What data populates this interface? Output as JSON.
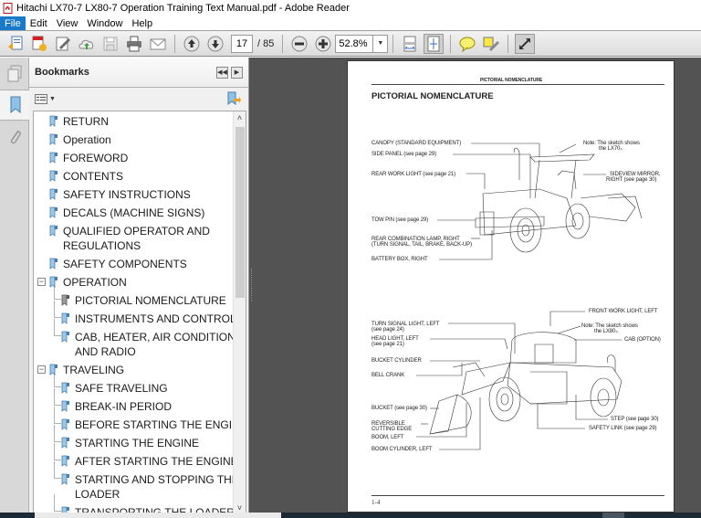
{
  "window": {
    "title": "Hitachi LX70-7 LX80-7 Operation Training Text Manual.pdf - Adobe Reader"
  },
  "menubar": {
    "items": [
      "File",
      "Edit",
      "View",
      "Window",
      "Help"
    ],
    "active": "File"
  },
  "toolbar": {
    "buttons": [
      {
        "icon": "create-pdf-icon",
        "label": "Create"
      },
      {
        "icon": "export-pdf-icon",
        "label": "Export"
      },
      {
        "icon": "sign-icon",
        "label": "Sign"
      },
      {
        "icon": "upload-cloud-icon",
        "label": "Upload"
      },
      {
        "icon": "save-icon",
        "label": "Save"
      },
      {
        "icon": "print-icon",
        "label": "Print"
      },
      {
        "icon": "email-icon",
        "label": "Email"
      }
    ],
    "current_page": "17",
    "total_pages": "/ 85",
    "zoom": "52.8%"
  },
  "panel": {
    "title": "Bookmarks",
    "bookmarks": [
      {
        "label": "RETURN",
        "level": 0
      },
      {
        "label": "Operation",
        "level": 0
      },
      {
        "label": "FOREWORD",
        "level": 0
      },
      {
        "label": "CONTENTS",
        "level": 0
      },
      {
        "label": "SAFETY INSTRUCTIONS",
        "level": 0
      },
      {
        "label": "DECALS (MACHINE SIGNS)",
        "level": 0
      },
      {
        "label": "QUALIFIED OPERATOR AND",
        "label2": "REGULATIONS",
        "level": 0
      },
      {
        "label": "SAFETY COMPONENTS",
        "level": 0
      },
      {
        "label": "OPERATION",
        "level": 0,
        "expanded": true
      },
      {
        "label": "PICTORIAL NOMENCLATURE",
        "level": 1,
        "current": true
      },
      {
        "label": "INSTRUMENTS AND CONTROLS",
        "level": 1
      },
      {
        "label": "CAB, HEATER, AIR CONDITIONER,",
        "label2": "AND RADIO",
        "level": 1
      },
      {
        "label": "TRAVELING",
        "level": 0,
        "expanded": true
      },
      {
        "label": "SAFE TRAVELING",
        "level": 1
      },
      {
        "label": "BREAK-IN PERIOD",
        "level": 1
      },
      {
        "label": "BEFORE STARTING THE ENGINE",
        "level": 1
      },
      {
        "label": "STARTING THE ENGINE",
        "level": 1
      },
      {
        "label": "AFTER STARTING THE ENGINE",
        "level": 1
      },
      {
        "label": "STARTING AND STOPPING THE",
        "label2": "LOADER",
        "level": 1
      },
      {
        "label": "TRANSPORTING THE LOADER",
        "level": 1
      }
    ]
  },
  "document": {
    "running_header": "PICTORIAL NOMENCLATURE",
    "heading": "PICTORIAL NOMENCLATURE",
    "figure1": {
      "labels": [
        "CANOPY (STANDARD EQUIPMENT)",
        "SIDE PANEL (see page 29)",
        "REAR WORK LIGHT (see page 21)",
        "TOW PIN (see page 29)",
        "REAR COMBINATION LAMP, RIGHT",
        "(TURN SIGNAL, TAIL, BRAKE, BACK-UP)",
        "BATTERY BOX, RIGHT"
      ],
      "note_line1": "Note: The sketch shows",
      "note_line2": "the LX70₇.",
      "right_label1": "SIDEVIEW MIRROR,",
      "right_label2": "RIGHT  (see page 30)"
    },
    "figure2": {
      "labels": [
        "TURN SIGNAL LIGHT, LEFT",
        "(see page 24)",
        "HEAD LIGHT, LEFT",
        "(see page 21)",
        "BUCKET CYLINDER",
        "BELL CRANK",
        "BUCKET (see page 30)",
        "REVERSIBLE",
        "CUTTING EDGE",
        "BOOM, LEFT",
        "BOOM CYLINDER, LEFT"
      ],
      "front_work_light": "FRONT WORK LIGHT, LEFT",
      "note_line1": "Note: The sketch shows",
      "note_line2": "the LX80₇.",
      "cab": "CAB (OPTION)",
      "step": "STEP (see page 30)",
      "safety_link": "SAFETY LINK (see page 29)"
    },
    "page_number": "1-4"
  }
}
